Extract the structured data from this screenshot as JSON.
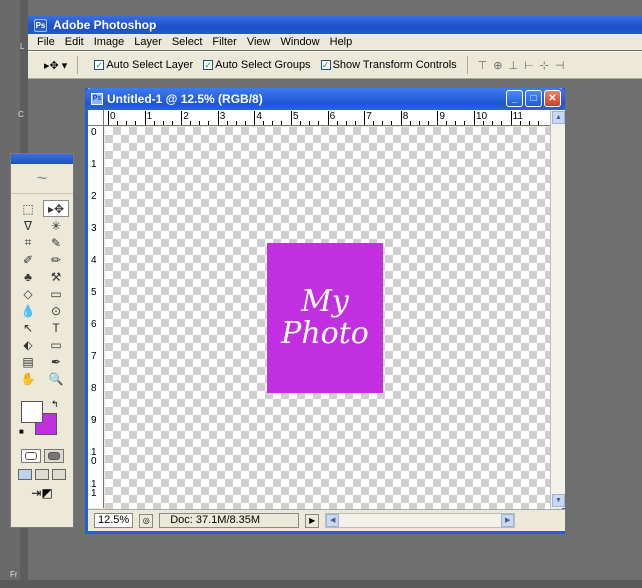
{
  "app": {
    "title": "Adobe Photoshop",
    "logo": "Ps"
  },
  "menu": [
    "File",
    "Edit",
    "Image",
    "Layer",
    "Select",
    "Filter",
    "View",
    "Window",
    "Help"
  ],
  "options": {
    "tool_glyph": "▸✥ ▾",
    "auto_select_layer": "Auto Select Layer",
    "auto_select_groups": "Auto Select Groups",
    "show_transform_controls": "Show Transform Controls",
    "check": "✓",
    "align_glyphs": [
      "⊤",
      "⊕",
      "⊥",
      "⊢",
      "⊹",
      "⊣"
    ]
  },
  "document": {
    "title": "Untitled-1 @ 12.5% (RGB/8)",
    "ruler_top": [
      "0",
      "1",
      "2",
      "3",
      "4",
      "5",
      "6",
      "7",
      "8",
      "9",
      "10",
      "11"
    ],
    "ruler_left": [
      "0",
      "1",
      "2",
      "3",
      "4",
      "5",
      "6",
      "7",
      "8",
      "9",
      "10",
      "11"
    ],
    "photo_text_line1": "My",
    "photo_text_line2": "Photo",
    "zoom": "12.5%",
    "doc_info": "Doc: 37.1M/8.35M",
    "minimize": "_",
    "maximize": "□",
    "close": "✕"
  },
  "toolbox": {
    "tools": [
      "⬚",
      "▸✥",
      "ᐁ",
      "✳",
      "⌗",
      "✎",
      "✐",
      "✏",
      "♣",
      "⚒",
      "◇",
      "▭",
      "💧",
      "⊙",
      "↖",
      "T",
      "⬖",
      "▭",
      "▤",
      "✒",
      "✋",
      "🔍"
    ]
  },
  "left_labels": {
    "top": "L",
    "mid": "C",
    "bottom": "Fr"
  },
  "colors": {
    "accent_purple": "#c22fe1",
    "titlebar_blue": "#245edb"
  }
}
